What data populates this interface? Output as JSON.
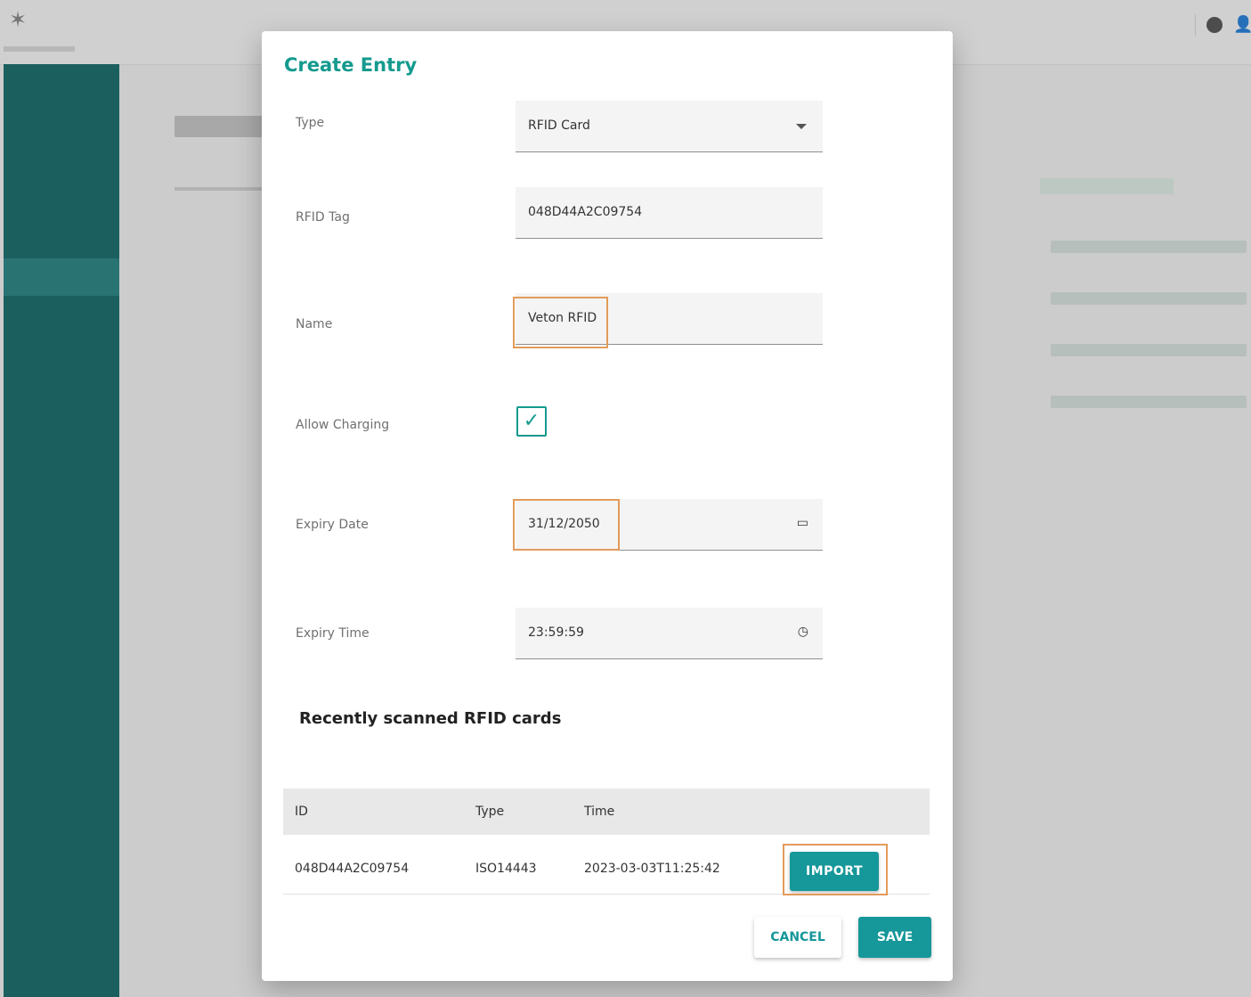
{
  "dialog": {
    "title": "Create Entry",
    "fields": {
      "type": {
        "label": "Type",
        "value": "RFID Card"
      },
      "rfid_tag": {
        "label": "RFID Tag",
        "value": "048D44A2C09754"
      },
      "name": {
        "label": "Name",
        "value": "Veton RFID"
      },
      "allow_charging": {
        "label": "Allow Charging",
        "checked": true
      },
      "expiry_date": {
        "label": "Expiry Date",
        "value": "31/12/2050"
      },
      "expiry_time": {
        "label": "Expiry Time",
        "value": "23:59:59"
      }
    },
    "recent_section": {
      "title": "Recently scanned RFID cards",
      "columns": [
        "ID",
        "Type",
        "Time"
      ],
      "rows": [
        {
          "id": "048D44A2C09754",
          "type": "ISO14443",
          "time": "2023-03-03T11:25:42",
          "action": "IMPORT"
        }
      ]
    },
    "buttons": {
      "cancel": "CANCEL",
      "save": "SAVE"
    }
  },
  "colors": {
    "accent": "#16979a",
    "title": "#149a8e",
    "highlight": "#e39b5b",
    "sidebar": "#0d6161"
  },
  "icons": {
    "type_dropdown": "caret-down-icon",
    "calendar": "calendar-icon",
    "clock": "clock-icon",
    "check": "check-icon"
  }
}
